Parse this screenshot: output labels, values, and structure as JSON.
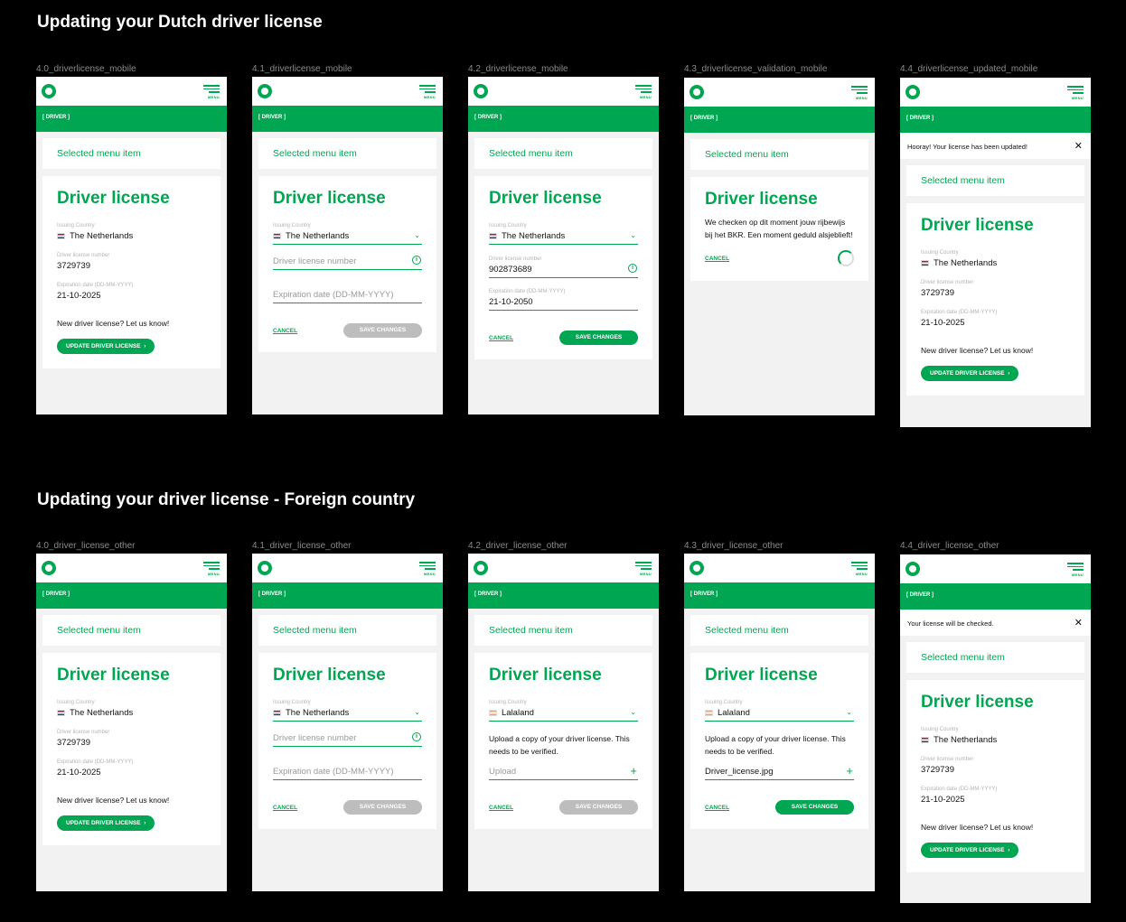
{
  "sections": [
    {
      "title": "Updating your Dutch driver license"
    },
    {
      "title": "Updating your driver license - Foreign country"
    }
  ],
  "common": {
    "menu_label": "MENU",
    "driver_bar": "[ DRIVER ]",
    "selected_item": "Selected menu item",
    "title": "Driver license",
    "issuing_country_label": "Issuing Country",
    "number_label": "Driver license number",
    "expiration_label": "Expiration date (DD-MM-YYYY)",
    "country_nl": "The Netherlands",
    "country_la": "Lalaland",
    "number": "3729739",
    "number_new": "902873689",
    "expiration": "21-10-2025",
    "expiration_new": "21-10-2050",
    "number_placeholder": "Driver license number",
    "expiration_placeholder": "Expiration date (DD-MM-YYYY)",
    "new_license_note": "New driver license? Let us know!",
    "update_button": "UPDATE DRIVER LICENSE",
    "cancel": "CANCEL",
    "save": "SAVE CHANGES",
    "upload_text": "Upload a copy of your driver license. This needs to be verified.",
    "upload_placeholder": "Upload",
    "upload_file": "Driver_license.jpg",
    "validation_text": "We checken op dit moment jouw rijbewijs bij het BKR. Een moment geduld alsjeblieft!",
    "notice_updated": "Hooray! Your license has been updated!",
    "notice_checked": "Your license will be checked.",
    "close": "✕"
  },
  "frames": [
    {
      "name": "4.0_driverlicense_mobile"
    },
    {
      "name": "4.1_driverlicense_mobile"
    },
    {
      "name": "4.2_driverlicense_mobile"
    },
    {
      "name": "4.3_driverlicense_validation_mobile"
    },
    {
      "name": "4.4_driverlicense_updated_mobile"
    },
    {
      "name": "4.0_driver_license_other"
    },
    {
      "name": "4.1_driver_license_other"
    },
    {
      "name": "4.2_driver_license_other"
    },
    {
      "name": "4.3_driver_license_other"
    },
    {
      "name": "4.4_driver_license_other"
    }
  ],
  "colors": {
    "brand": "#00a651",
    "disabled": "#bdbdbd"
  }
}
